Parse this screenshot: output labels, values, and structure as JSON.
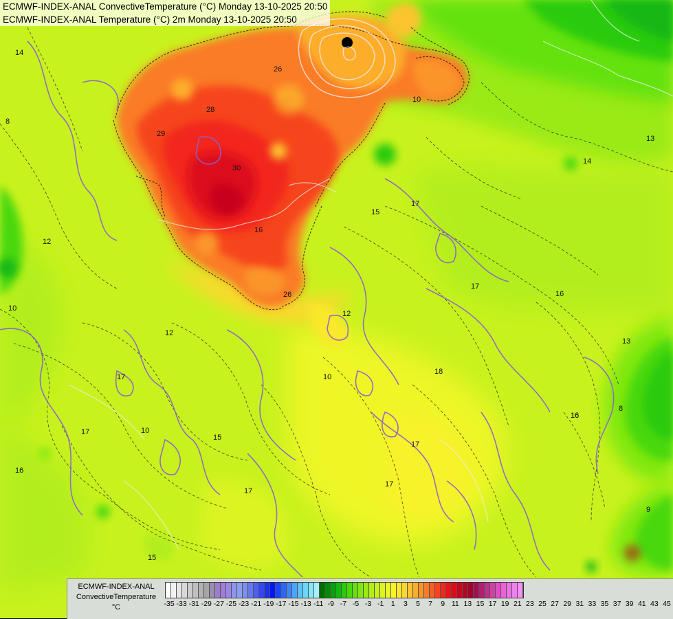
{
  "title_lines": [
    "ECMWF-INDEX-ANAL ConvectiveTemperature (°C) Monday 13-10-2025 20:50",
    "ECMWF-INDEX-ANAL Temperature (°C) 2m Monday 13-10-2025 20:50"
  ],
  "legend": {
    "model": "ECMWF-INDEX-ANAL",
    "parameter": "ConvectiveTemperature",
    "unit": "°C",
    "ticks": [
      "-35",
      "-33",
      "-31",
      "-29",
      "-27",
      "-25",
      "-23",
      "-21",
      "-19",
      "-17",
      "-15",
      "-13",
      "-11",
      "-9",
      "-7",
      "-5",
      "-3",
      "-1",
      "1",
      "3",
      "5",
      "7",
      "9",
      "11",
      "13",
      "15",
      "17",
      "19",
      "21",
      "23",
      "25",
      "27",
      "29",
      "31",
      "33",
      "35",
      "37",
      "39",
      "41",
      "43",
      "45"
    ],
    "colors": [
      "#ffffff",
      "#f2f2f2",
      "#e6e6e6",
      "#d9d9d9",
      "#cccccc",
      "#bfbfbf",
      "#b3b3b3",
      "#a6a6a6",
      "#9a8fae",
      "#9b7fc8",
      "#a37bdc",
      "#9a86e6",
      "#9094ee",
      "#8aa0ee",
      "#7f8ff0",
      "#6677f2",
      "#4d5ff2",
      "#3347f2",
      "#1a30f2",
      "#0019f2",
      "#1f44f5",
      "#2e66f6",
      "#3d86f7",
      "#4ca5f8",
      "#5bc3f9",
      "#6ad6fa",
      "#86e6fb",
      "#a5f0fc",
      "#006b00",
      "#008a00",
      "#00a300",
      "#12b812",
      "#2ccb0c",
      "#48d80a",
      "#64e20a",
      "#7fe810",
      "#9aea14",
      "#b2ee1a",
      "#c8f21e",
      "#dcf422",
      "#eef626",
      "#f8f22a",
      "#fae82c",
      "#fcd82e",
      "#fcc42e",
      "#fcae2c",
      "#fb952a",
      "#fa7b26",
      "#f86022",
      "#f6441e",
      "#f2281a",
      "#ea1416",
      "#dc0a1a",
      "#c8061e",
      "#b40624",
      "#a0062c",
      "#a01050",
      "#b0206e",
      "#c0308a",
      "#d040a6",
      "#e050c2",
      "#ee60d8",
      "#f070e6",
      "#f080f0",
      "#f590f5"
    ]
  },
  "contour_labels": [
    {
      "text": "14"
    },
    {
      "text": "12"
    },
    {
      "text": "8"
    },
    {
      "text": "10"
    },
    {
      "text": "17"
    },
    {
      "text": "17"
    },
    {
      "text": "16"
    },
    {
      "text": "15"
    },
    {
      "text": "17"
    },
    {
      "text": "16"
    },
    {
      "text": "17"
    },
    {
      "text": "17"
    },
    {
      "text": "15"
    },
    {
      "text": "12"
    },
    {
      "text": "10"
    },
    {
      "text": "10"
    },
    {
      "text": "16"
    },
    {
      "text": "17"
    },
    {
      "text": "18"
    },
    {
      "text": "16"
    },
    {
      "text": "17"
    },
    {
      "text": "16"
    },
    {
      "text": "13"
    },
    {
      "text": "13"
    },
    {
      "text": "14"
    },
    {
      "text": "9"
    },
    {
      "text": "8"
    },
    {
      "text": "28"
    },
    {
      "text": "29"
    },
    {
      "text": "30"
    },
    {
      "text": "26"
    },
    {
      "text": "26"
    },
    {
      "text": "10"
    },
    {
      "text": "12"
    },
    {
      "text": "15"
    }
  ]
}
